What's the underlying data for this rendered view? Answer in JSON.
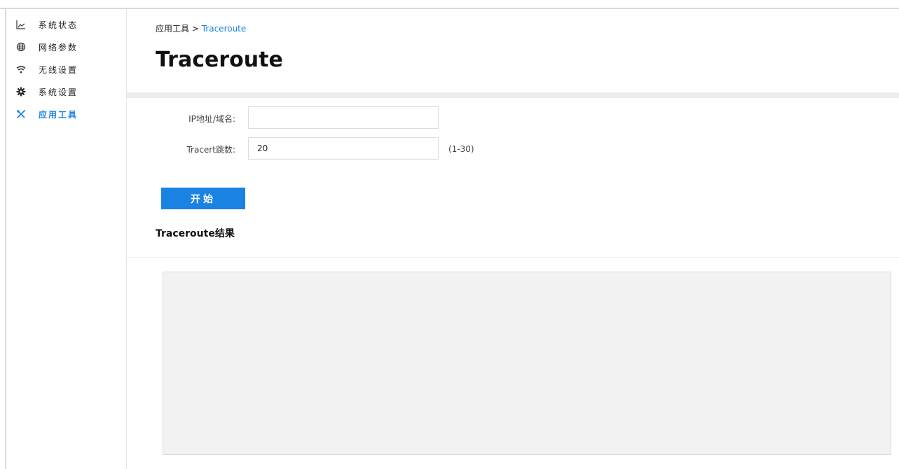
{
  "sidebar": {
    "items": [
      {
        "label": "系统状态",
        "icon": "line-chart-icon",
        "active": false
      },
      {
        "label": "网络参数",
        "icon": "globe-icon",
        "active": false
      },
      {
        "label": "无线设置",
        "icon": "wifi-icon",
        "active": false
      },
      {
        "label": "系统设置",
        "icon": "gear-icon",
        "active": false
      },
      {
        "label": "应用工具",
        "icon": "tools-icon",
        "active": true
      }
    ]
  },
  "header": {
    "breadcrumb_parent": "应用工具",
    "breadcrumb_separator": ">",
    "breadcrumb_current": "Traceroute",
    "title": "Traceroute"
  },
  "form": {
    "ip_label": "IP地址/域名:",
    "ip_value": "",
    "hops_label": "Tracert跳数:",
    "hops_value": "20",
    "hops_hint": "(1-30)"
  },
  "actions": {
    "start_label": "开始"
  },
  "result": {
    "title": "Traceroute结果",
    "content": ""
  },
  "colors": {
    "accent": "#1a82e2",
    "band": "#ececec",
    "result_bg": "#f2f2f2"
  }
}
